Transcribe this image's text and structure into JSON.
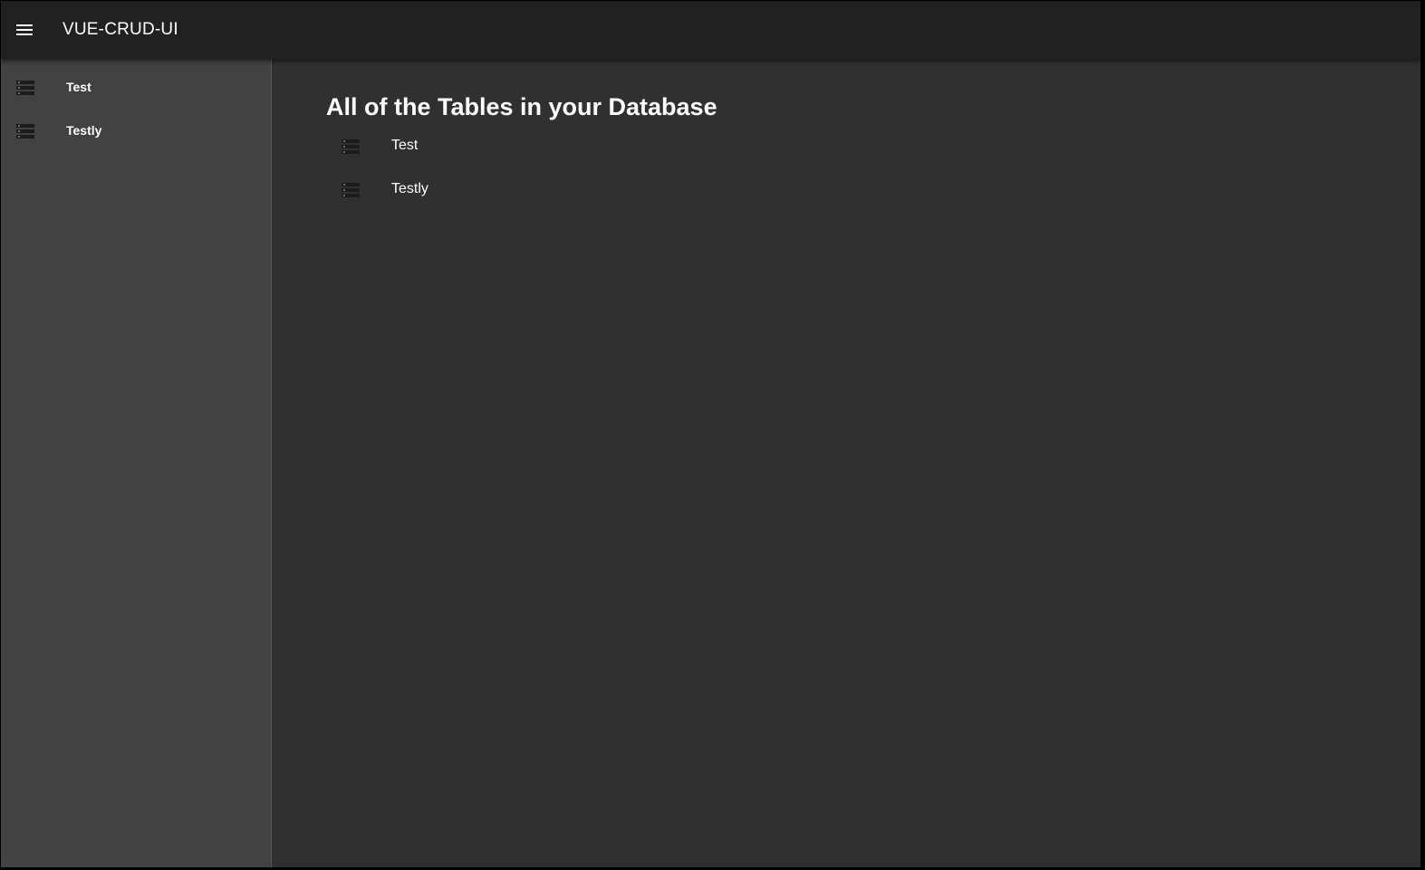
{
  "app": {
    "title": "VUE-CRUD-UI",
    "menu_icon": "menu-icon"
  },
  "sidebar": {
    "items": [
      {
        "label": "Test",
        "icon": "storage-icon"
      },
      {
        "label": "Testly",
        "icon": "storage-icon"
      }
    ]
  },
  "main": {
    "title": "All of the Tables in your Database",
    "tables": [
      {
        "label": "Test",
        "icon": "storage-icon"
      },
      {
        "label": "Testly",
        "icon": "storage-icon"
      }
    ]
  },
  "colors": {
    "toolbar": "#212121",
    "sidebar": "#424242",
    "background": "#303030",
    "text": "#ffffff"
  }
}
